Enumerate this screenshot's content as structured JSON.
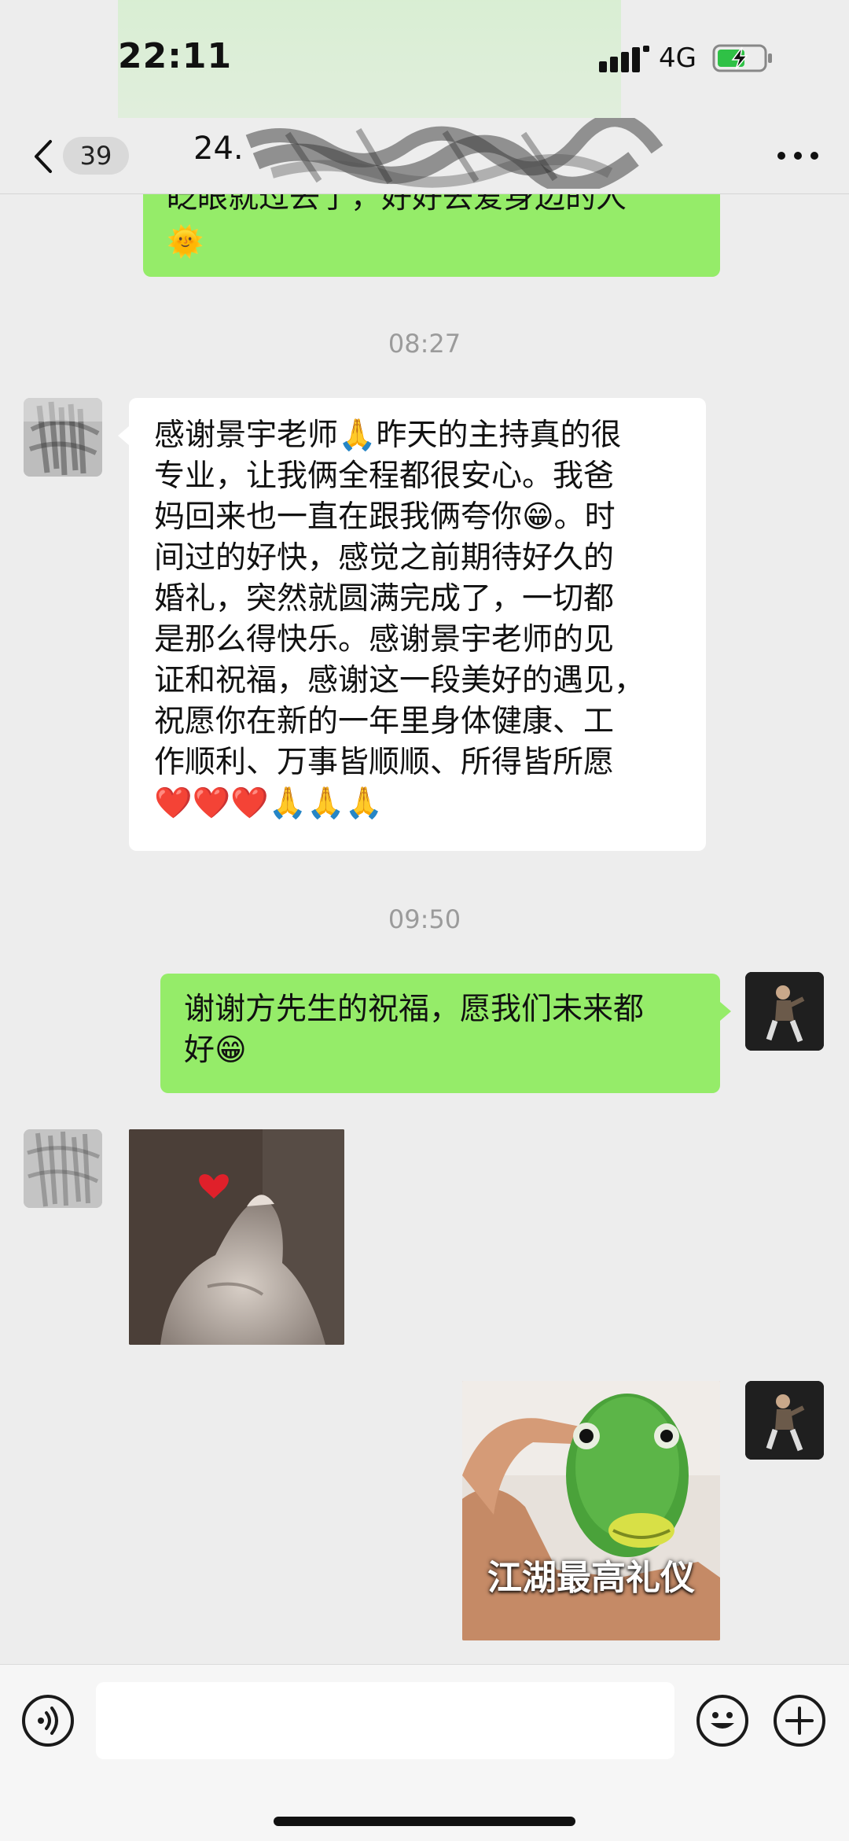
{
  "status_bar": {
    "time": "22:11",
    "network": "4G"
  },
  "nav": {
    "unread_count": "39",
    "title_visible": "24."
  },
  "messages": {
    "partial_out": {
      "text": "眨眼就过去了，好好去爱身边的人",
      "emoji": "🌞"
    },
    "timestamp_1": "08:27",
    "incoming_1": {
      "lines": [
        "感谢景宇老师🙏昨天的主持真的很",
        "专业，让我俩全程都很安心。我爸",
        "妈回来也一直在跟我俩夸你😁。时",
        "间过的好快，感觉之前期待好久的",
        "婚礼，突然就圆满完成了，一切都",
        "是那么得快乐。感谢景宇老师的见",
        "证和祝福，感谢这一段美好的遇见，",
        "祝愿你在新的一年里身体健康、工",
        "作顺利、万事皆顺顺、所得皆所愿",
        "❤️❤️❤️🙏🙏🙏"
      ]
    },
    "timestamp_2": "09:50",
    "outgoing_1": {
      "lines": [
        "谢谢方先生的祝福，愿我们未来都",
        "好😁"
      ]
    },
    "sticker_out": {
      "caption": "江湖最高礼仪"
    }
  },
  "input_bar": {
    "placeholder": ""
  },
  "icons": {
    "back": "chevron-left-icon",
    "more": "more-dots-icon",
    "voice": "voice-icon",
    "emoji": "emoji-icon",
    "plus": "plus-icon"
  },
  "colors": {
    "bubble_out": "#95ec69",
    "bubble_in": "#ffffff",
    "background": "#ededed",
    "timestamp": "#9b9b9b"
  }
}
